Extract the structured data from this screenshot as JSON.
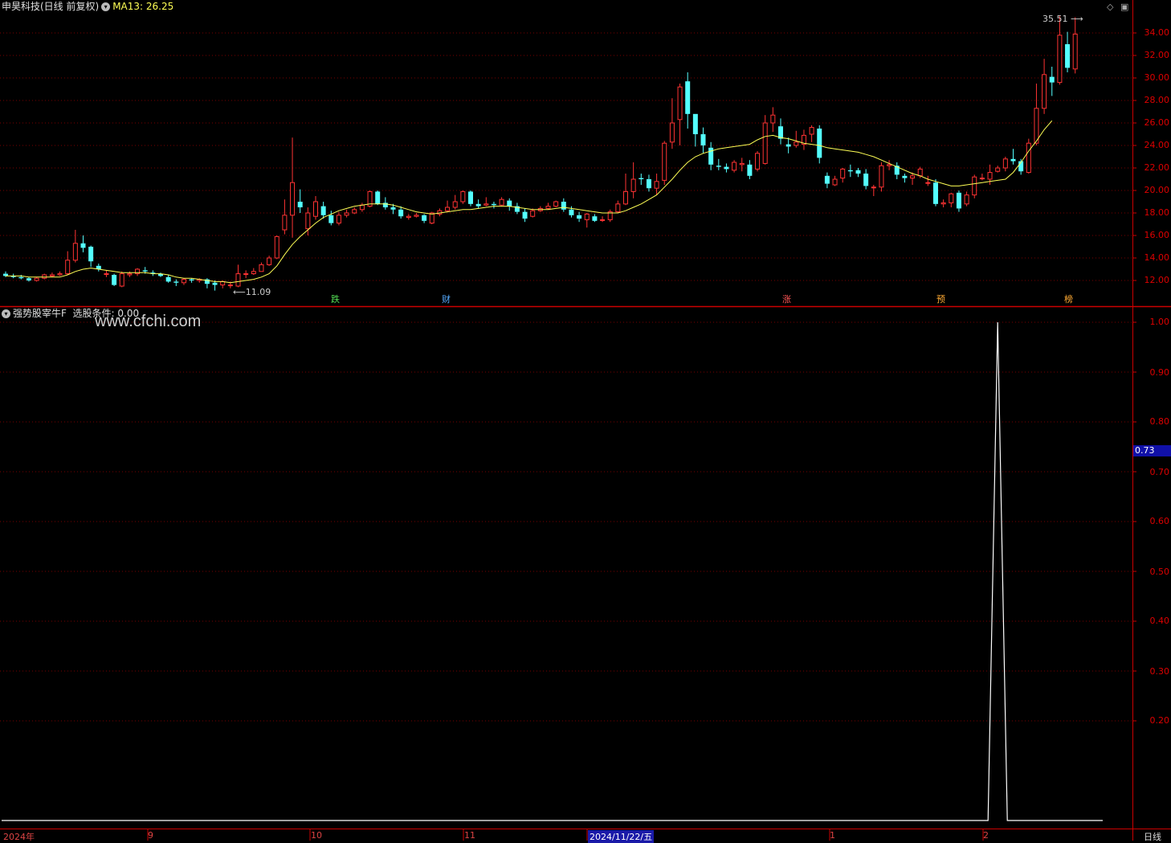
{
  "header": {
    "stock_title": "申昊科技(日线 前复权)",
    "ma_label": "MA13: 26.25",
    "indicator_title": "强势股宰牛F",
    "indicator_value": "选股条件: 0.00",
    "watermark": "www.cfchi.com"
  },
  "price_axis": [
    "34.00",
    "32.00",
    "30.00",
    "28.00",
    "26.00",
    "24.00",
    "22.00",
    "20.00",
    "18.00",
    "16.00",
    "14.00",
    "12.00"
  ],
  "indicator_axis": [
    "1.00",
    "0.90",
    "0.80",
    "0.70",
    "0.60",
    "0.50",
    "0.40",
    "0.30",
    "0.20"
  ],
  "indicator_current": "0.73",
  "extremes": {
    "high": "35.51",
    "low": "11.09"
  },
  "event_tags": [
    {
      "text": "跌",
      "color": "#55dd55"
    },
    {
      "text": "财",
      "color": "#55aaff"
    },
    {
      "text": "涨",
      "color": "#ff5555"
    },
    {
      "text": "预",
      "color": "#ffaa33"
    },
    {
      "text": "榜",
      "color": "#ffaa33"
    }
  ],
  "date_axis": [
    "2024年",
    "9",
    "10",
    "11",
    "1",
    "2"
  ],
  "date_selected": "2024/11/22/五",
  "period_label": "日线",
  "colors": {
    "up": "#ff3333",
    "down": "#54ffff",
    "ma": "#ffff55",
    "grid": "#7a0000",
    "axis": "#cc0000",
    "signal": "#ffffff"
  },
  "chart_data": {
    "type": "candlestick",
    "price_range": [
      11.0,
      36.0
    ],
    "ma_period": 13,
    "ma_last": 26.25,
    "candles": [
      [
        12.6,
        12.4,
        12.8,
        12.3
      ],
      [
        12.4,
        12.3,
        12.6,
        12.2
      ],
      [
        12.3,
        12.2,
        12.5,
        12.1
      ],
      [
        12.2,
        12.0,
        12.3,
        11.9
      ],
      [
        12.0,
        12.2,
        12.3,
        11.9
      ],
      [
        12.2,
        12.5,
        12.6,
        12.1
      ],
      [
        12.4,
        12.5,
        12.7,
        12.3
      ],
      [
        12.5,
        12.6,
        12.8,
        12.4
      ],
      [
        12.6,
        13.8,
        14.6,
        12.5
      ],
      [
        13.8,
        15.3,
        16.5,
        13.6
      ],
      [
        15.3,
        14.9,
        16.0,
        14.5
      ],
      [
        15.0,
        13.7,
        15.1,
        13.2
      ],
      [
        13.3,
        13.0,
        13.5,
        12.8
      ],
      [
        12.6,
        12.6,
        12.9,
        12.3
      ],
      [
        12.5,
        11.6,
        12.6,
        11.5
      ],
      [
        11.5,
        12.6,
        12.8,
        11.4
      ],
      [
        12.5,
        12.6,
        12.8,
        12.3
      ],
      [
        12.6,
        13.0,
        13.1,
        12.4
      ],
      [
        12.9,
        12.8,
        13.2,
        12.6
      ],
      [
        12.7,
        12.6,
        12.9,
        12.4
      ],
      [
        12.6,
        12.4,
        12.7,
        12.3
      ],
      [
        12.3,
        11.9,
        12.5,
        11.8
      ],
      [
        11.9,
        11.8,
        12.1,
        11.5
      ],
      [
        11.8,
        12.1,
        12.2,
        11.6
      ],
      [
        12.1,
        12.0,
        12.2,
        11.8
      ],
      [
        12.0,
        12.1,
        12.2,
        11.8
      ],
      [
        12.1,
        11.7,
        12.2,
        11.3
      ],
      [
        11.8,
        11.6,
        12.0,
        11.1
      ],
      [
        11.6,
        11.9,
        12.0,
        11.3
      ],
      [
        11.6,
        11.6,
        11.9,
        11.3
      ],
      [
        11.5,
        12.6,
        13.4,
        11.4
      ],
      [
        12.6,
        12.6,
        12.9,
        12.2
      ],
      [
        12.6,
        12.8,
        13.1,
        12.5
      ],
      [
        12.8,
        13.4,
        13.6,
        12.8
      ],
      [
        13.4,
        14.0,
        14.2,
        13.3
      ],
      [
        14.0,
        15.9,
        16.0,
        13.9
      ],
      [
        16.5,
        17.8,
        19.2,
        16.1
      ],
      [
        17.8,
        20.7,
        24.7,
        15.8
      ],
      [
        19.0,
        18.5,
        20.1,
        18.0
      ],
      [
        16.6,
        18.0,
        18.5,
        16.0
      ],
      [
        17.7,
        19.0,
        19.5,
        17.4
      ],
      [
        18.6,
        17.8,
        19.0,
        17.5
      ],
      [
        17.8,
        17.1,
        18.2,
        16.9
      ],
      [
        17.1,
        17.8,
        18.1,
        16.9
      ],
      [
        17.8,
        18.0,
        18.3,
        17.6
      ],
      [
        18.0,
        18.3,
        18.5,
        17.9
      ],
      [
        18.3,
        18.7,
        18.9,
        18.1
      ],
      [
        18.6,
        19.9,
        20.0,
        18.5
      ],
      [
        19.9,
        18.8,
        20.0,
        18.7
      ],
      [
        18.9,
        18.5,
        19.4,
        18.3
      ],
      [
        18.5,
        18.3,
        18.8,
        17.9
      ],
      [
        18.3,
        17.7,
        18.6,
        17.5
      ],
      [
        17.6,
        17.7,
        17.9,
        17.4
      ],
      [
        17.7,
        17.8,
        18.0,
        17.6
      ],
      [
        17.8,
        17.3,
        17.9,
        17.1
      ],
      [
        17.1,
        18.0,
        18.1,
        17.0
      ],
      [
        17.9,
        18.2,
        18.4,
        17.7
      ],
      [
        18.2,
        18.5,
        19.1,
        18.1
      ],
      [
        18.5,
        19.0,
        19.6,
        18.3
      ],
      [
        19.0,
        19.9,
        20.0,
        18.8
      ],
      [
        19.9,
        18.8,
        20.0,
        18.6
      ],
      [
        18.8,
        18.6,
        19.2,
        18.4
      ],
      [
        18.7,
        18.8,
        19.4,
        18.6
      ],
      [
        18.8,
        18.7,
        19.0,
        18.4
      ],
      [
        18.7,
        19.2,
        19.4,
        18.6
      ],
      [
        19.1,
        18.6,
        19.3,
        18.2
      ],
      [
        18.6,
        18.1,
        18.9,
        17.9
      ],
      [
        18.1,
        17.5,
        18.4,
        17.2
      ],
      [
        17.7,
        18.2,
        18.4,
        17.6
      ],
      [
        18.2,
        18.4,
        18.6,
        18.1
      ],
      [
        18.4,
        18.6,
        18.9,
        18.3
      ],
      [
        18.6,
        19.0,
        19.1,
        18.5
      ],
      [
        19.0,
        18.3,
        19.3,
        18.1
      ],
      [
        18.3,
        17.8,
        18.6,
        17.6
      ],
      [
        17.8,
        17.5,
        18.1,
        17.2
      ],
      [
        17.4,
        17.9,
        18.0,
        16.7
      ],
      [
        17.7,
        17.3,
        17.9,
        17.2
      ],
      [
        17.4,
        17.4,
        17.7,
        17.2
      ],
      [
        17.4,
        18.1,
        18.3,
        17.2
      ],
      [
        18.1,
        18.8,
        19.1,
        18.0
      ],
      [
        18.8,
        19.9,
        21.5,
        18.7
      ],
      [
        19.9,
        21.0,
        22.5,
        19.3
      ],
      [
        21.1,
        21.0,
        21.5,
        20.5
      ],
      [
        21.0,
        20.2,
        21.4,
        19.9
      ],
      [
        20.2,
        20.8,
        21.5,
        19.6
      ],
      [
        20.9,
        24.2,
        24.4,
        20.5
      ],
      [
        24.3,
        26.0,
        28.2,
        23.7
      ],
      [
        26.3,
        29.2,
        29.5,
        24.0
      ],
      [
        29.7,
        26.8,
        30.5,
        25.5
      ],
      [
        26.8,
        25.0,
        26.0,
        23.9
      ],
      [
        25.0,
        24.0,
        25.6,
        23.3
      ],
      [
        23.8,
        22.3,
        24.3,
        21.8
      ],
      [
        22.2,
        22.1,
        22.8,
        21.8
      ],
      [
        22.1,
        21.9,
        22.4,
        21.6
      ],
      [
        21.8,
        22.5,
        22.7,
        21.6
      ],
      [
        22.3,
        22.4,
        22.9,
        21.7
      ],
      [
        22.3,
        21.3,
        22.7,
        21.0
      ],
      [
        21.9,
        23.3,
        23.5,
        21.7
      ],
      [
        22.4,
        26.0,
        26.7,
        22.3
      ],
      [
        26.0,
        26.7,
        27.4,
        25.2
      ],
      [
        25.7,
        24.6,
        26.4,
        24.1
      ],
      [
        24.1,
        23.9,
        24.7,
        23.3
      ],
      [
        24.0,
        24.3,
        25.3,
        23.8
      ],
      [
        24.1,
        24.9,
        25.4,
        23.6
      ],
      [
        25.0,
        25.6,
        25.8,
        24.3
      ],
      [
        25.5,
        22.9,
        25.8,
        22.4
      ],
      [
        21.3,
        20.6,
        21.6,
        20.2
      ],
      [
        20.5,
        21.0,
        21.3,
        20.4
      ],
      [
        21.1,
        21.9,
        22.0,
        20.7
      ],
      [
        21.8,
        21.7,
        22.3,
        21.2
      ],
      [
        21.8,
        21.5,
        22.0,
        21.2
      ],
      [
        21.5,
        20.4,
        21.9,
        20.1
      ],
      [
        20.3,
        20.3,
        20.5,
        19.5
      ],
      [
        20.3,
        22.2,
        22.5,
        19.9
      ],
      [
        22.2,
        22.3,
        22.7,
        21.8
      ],
      [
        22.2,
        21.4,
        22.5,
        21.0
      ],
      [
        21.3,
        21.1,
        21.5,
        20.7
      ],
      [
        21.1,
        21.3,
        21.6,
        20.5
      ],
      [
        21.3,
        21.9,
        22.1,
        21.1
      ],
      [
        20.7,
        20.7,
        21.3,
        20.4
      ],
      [
        20.7,
        18.8,
        21.0,
        18.6
      ],
      [
        18.8,
        18.9,
        19.2,
        18.5
      ],
      [
        18.9,
        19.7,
        19.8,
        18.5
      ],
      [
        19.8,
        18.4,
        20.0,
        18.1
      ],
      [
        18.8,
        19.6,
        19.9,
        18.6
      ],
      [
        19.6,
        21.2,
        21.4,
        19.3
      ],
      [
        21.1,
        21.1,
        21.5,
        20.9
      ],
      [
        21.0,
        21.6,
        22.3,
        20.5
      ],
      [
        21.7,
        22.0,
        22.2,
        21.6
      ],
      [
        22.0,
        22.8,
        23.0,
        21.7
      ],
      [
        22.8,
        22.6,
        23.7,
        22.3
      ],
      [
        22.6,
        21.7,
        22.8,
        21.4
      ],
      [
        21.6,
        24.2,
        24.6,
        21.5
      ],
      [
        24.2,
        27.3,
        29.5,
        24.0
      ],
      [
        27.3,
        30.3,
        31.7,
        26.8
      ],
      [
        30.1,
        29.6,
        31.0,
        28.4
      ],
      [
        29.6,
        33.8,
        35.5,
        29.4
      ],
      [
        33.0,
        30.9,
        34.1,
        30.5
      ],
      [
        30.8,
        33.9,
        35.4,
        30.4
      ]
    ],
    "ma13": [
      12.4,
      12.4,
      12.4,
      12.3,
      12.3,
      12.3,
      12.3,
      12.3,
      12.5,
      12.8,
      13.0,
      13.1,
      13.0,
      12.9,
      12.8,
      12.7,
      12.7,
      12.7,
      12.7,
      12.6,
      12.6,
      12.5,
      12.3,
      12.2,
      12.2,
      12.1,
      12.0,
      11.9,
      11.9,
      11.8,
      11.9,
      12.0,
      12.1,
      12.3,
      12.6,
      13.3,
      14.3,
      15.2,
      15.9,
      16.5,
      17.1,
      17.6,
      17.9,
      18.2,
      18.4,
      18.6,
      18.7,
      18.8,
      18.8,
      18.8,
      18.7,
      18.5,
      18.3,
      18.1,
      18.0,
      17.9,
      18.0,
      18.1,
      18.2,
      18.3,
      18.3,
      18.4,
      18.5,
      18.6,
      18.6,
      18.6,
      18.5,
      18.4,
      18.3,
      18.3,
      18.3,
      18.4,
      18.5,
      18.4,
      18.3,
      18.2,
      18.1,
      18.0,
      18.0,
      18.0,
      18.2,
      18.5,
      18.8,
      19.2,
      19.6,
      20.3,
      21.0,
      21.8,
      22.5,
      23.0,
      23.3,
      23.5,
      23.7,
      23.8,
      23.9,
      24.0,
      24.1,
      24.5,
      24.8,
      24.9,
      24.7,
      24.6,
      24.4,
      24.2,
      24.1,
      24.0,
      23.8,
      23.7,
      23.6,
      23.5,
      23.4,
      23.2,
      23.0,
      22.7,
      22.4,
      22.1,
      21.8,
      21.5,
      21.3,
      21.0,
      20.8,
      20.6,
      20.4,
      20.4,
      20.5,
      20.6,
      20.7,
      20.8,
      20.9,
      21.0,
      21.6,
      22.5,
      23.5,
      24.4,
      25.4,
      26.2
    ]
  },
  "signal_data": {
    "range": [
      0.0,
      1.05
    ],
    "spike_index": 128,
    "spike_value": 1.0
  }
}
